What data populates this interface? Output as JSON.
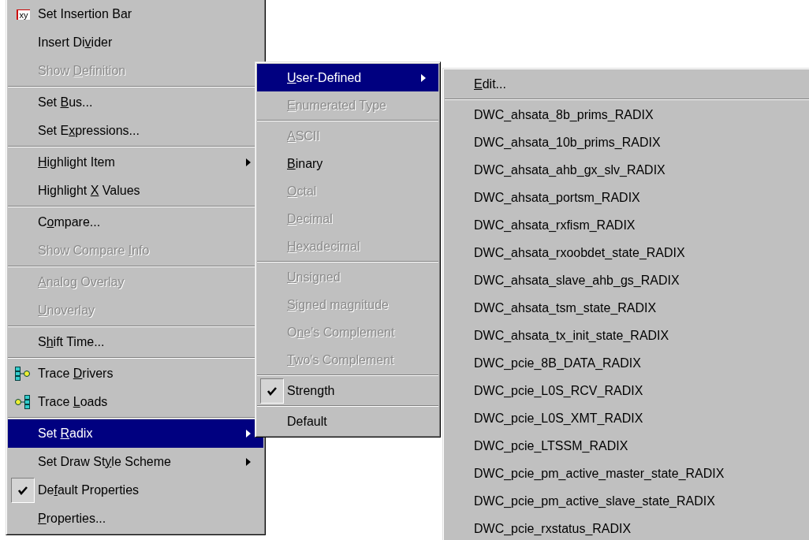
{
  "menus": [
    {
      "kind": "main",
      "items": [
        {
          "kind": "xy",
          "icon_label": "xy",
          "label": "Set Insertion Bar",
          "disabled": false,
          "selected": false,
          "checked": false,
          "submenu": false
        },
        {
          "kind": "item",
          "label": "Insert Di",
          "key": "v",
          "rest": "ider",
          "disabled": false,
          "selected": false,
          "checked": false,
          "submenu": false
        },
        {
          "kind": "item",
          "label": "Show ",
          "key": "D",
          "rest": "efinition",
          "disabled": true,
          "selected": false,
          "checked": false,
          "submenu": false
        },
        {
          "kind": "separator"
        },
        {
          "kind": "item",
          "label": "Set ",
          "key": "B",
          "rest": "us...",
          "disabled": false,
          "selected": false,
          "checked": false,
          "submenu": false
        },
        {
          "kind": "item",
          "label": "Set E",
          "key": "x",
          "rest": "pressions...",
          "disabled": false,
          "selected": false,
          "checked": false,
          "submenu": false
        },
        {
          "kind": "separator"
        },
        {
          "kind": "item",
          "key": "H",
          "rest": "ighlight Item",
          "disabled": false,
          "selected": false,
          "checked": false,
          "submenu": true
        },
        {
          "kind": "item",
          "label": "Highlight ",
          "key": "X",
          "rest": " Values",
          "disabled": false,
          "selected": false,
          "checked": false,
          "submenu": false
        },
        {
          "kind": "separator"
        },
        {
          "kind": "item",
          "label": "C",
          "key": "o",
          "rest": "mpare...",
          "disabled": false,
          "selected": false,
          "checked": false,
          "submenu": false
        },
        {
          "kind": "item",
          "label": "Show Compare ",
          "key": "I",
          "rest": "nfo",
          "disabled": true,
          "selected": false,
          "checked": false,
          "submenu": false
        },
        {
          "kind": "separator"
        },
        {
          "kind": "item",
          "key": "A",
          "rest": "nalog Overlay",
          "disabled": true,
          "selected": false,
          "checked": false,
          "submenu": false
        },
        {
          "kind": "item",
          "key": "U",
          "rest": "noverlay",
          "disabled": true,
          "selected": false,
          "checked": false,
          "submenu": false
        },
        {
          "kind": "separator"
        },
        {
          "kind": "item",
          "label": "S",
          "key": "h",
          "rest": "ift Time...",
          "disabled": false,
          "selected": false,
          "checked": false,
          "submenu": false
        },
        {
          "kind": "separator"
        },
        {
          "kind": "drivers",
          "label": "Trace ",
          "key": "D",
          "rest": "rivers",
          "disabled": false,
          "selected": false,
          "checked": false,
          "submenu": false
        },
        {
          "kind": "loads",
          "label": "Trace ",
          "key": "L",
          "rest": "oads",
          "disabled": false,
          "selected": false,
          "checked": false,
          "submenu": false
        },
        {
          "kind": "separator"
        },
        {
          "kind": "item",
          "label": "Set ",
          "key": "R",
          "rest": "adix",
          "disabled": false,
          "selected": true,
          "checked": false,
          "submenu": true
        },
        {
          "kind": "item",
          "label": "Set Draw St",
          "key": "y",
          "rest": "le Scheme",
          "disabled": false,
          "selected": false,
          "checked": false,
          "submenu": true
        },
        {
          "kind": "item",
          "label": "De",
          "key": "f",
          "rest": "ault Properties",
          "disabled": false,
          "selected": false,
          "checked": true,
          "submenu": false
        },
        {
          "kind": "item",
          "key": "P",
          "rest": "roperties...",
          "disabled": false,
          "selected": false,
          "checked": false,
          "submenu": false
        }
      ]
    },
    {
      "kind": "radix",
      "items": [
        {
          "kind": "item",
          "key": "U",
          "rest": "ser-Defined",
          "disabled": false,
          "selected": true,
          "checked": false,
          "submenu": true
        },
        {
          "kind": "item",
          "key": "E",
          "rest": "numerated Type",
          "disabled": true,
          "selected": false,
          "checked": false,
          "submenu": false
        },
        {
          "kind": "separator"
        },
        {
          "kind": "item",
          "key": "A",
          "rest": "SCII",
          "disabled": true,
          "selected": false,
          "checked": false,
          "submenu": false
        },
        {
          "kind": "item",
          "key": "B",
          "rest": "inary",
          "disabled": false,
          "selected": false,
          "checked": false,
          "submenu": false
        },
        {
          "kind": "item",
          "key": "O",
          "rest": "ctal",
          "disabled": true,
          "selected": false,
          "checked": false,
          "submenu": false
        },
        {
          "kind": "item",
          "key": "D",
          "rest": "ecimal",
          "disabled": true,
          "selected": false,
          "checked": false,
          "submenu": false
        },
        {
          "kind": "item",
          "key": "H",
          "rest": "exadecimal",
          "disabled": true,
          "selected": false,
          "checked": false,
          "submenu": false
        },
        {
          "kind": "separator"
        },
        {
          "kind": "item",
          "key": "U",
          "rest": "nsigned",
          "disabled": true,
          "selected": false,
          "checked": false,
          "submenu": false
        },
        {
          "kind": "item",
          "key": "S",
          "rest": "igned magnitude",
          "disabled": true,
          "selected": false,
          "checked": false,
          "submenu": false
        },
        {
          "kind": "item",
          "label": "O",
          "key": "n",
          "rest": "e's Complement",
          "disabled": true,
          "selected": false,
          "checked": false,
          "submenu": false
        },
        {
          "kind": "item",
          "key": "T",
          "rest": "wo's Complement",
          "disabled": true,
          "selected": false,
          "checked": false,
          "submenu": false
        },
        {
          "kind": "separator"
        },
        {
          "kind": "item",
          "label": "Strength",
          "disabled": false,
          "selected": false,
          "checked": true,
          "submenu": false
        },
        {
          "kind": "separator"
        },
        {
          "kind": "item",
          "label": "Default",
          "disabled": false,
          "selected": false,
          "checked": false,
          "submenu": false
        }
      ]
    },
    {
      "kind": "user",
      "items": [
        {
          "kind": "item",
          "key": "E",
          "rest": "dit...",
          "disabled": false,
          "selected": false,
          "checked": false,
          "submenu": false
        },
        {
          "kind": "separator"
        },
        {
          "kind": "item",
          "label": "DWC_ahsata_8b_prims_RADIX",
          "disabled": false,
          "selected": false,
          "checked": false,
          "submenu": false
        },
        {
          "kind": "item",
          "label": "DWC_ahsata_10b_prims_RADIX",
          "disabled": false,
          "selected": false,
          "checked": false,
          "submenu": false
        },
        {
          "kind": "item",
          "label": "DWC_ahsata_ahb_gx_slv_RADIX",
          "disabled": false,
          "selected": false,
          "checked": false,
          "submenu": false
        },
        {
          "kind": "item",
          "label": "DWC_ahsata_portsm_RADIX",
          "disabled": false,
          "selected": false,
          "checked": false,
          "submenu": false
        },
        {
          "kind": "item",
          "label": "DWC_ahsata_rxfism_RADIX",
          "disabled": false,
          "selected": false,
          "checked": false,
          "submenu": false
        },
        {
          "kind": "item",
          "label": "DWC_ahsata_rxoobdet_state_RADIX",
          "disabled": false,
          "selected": false,
          "checked": false,
          "submenu": false
        },
        {
          "kind": "item",
          "label": "DWC_ahsata_slave_ahb_gs_RADIX",
          "disabled": false,
          "selected": false,
          "checked": false,
          "submenu": false
        },
        {
          "kind": "item",
          "label": "DWC_ahsata_tsm_state_RADIX",
          "disabled": false,
          "selected": false,
          "checked": false,
          "submenu": false
        },
        {
          "kind": "item",
          "label": "DWC_ahsata_tx_init_state_RADIX",
          "disabled": false,
          "selected": false,
          "checked": false,
          "submenu": false
        },
        {
          "kind": "item",
          "label": "DWC_pcie_8B_DATA_RADIX",
          "disabled": false,
          "selected": false,
          "checked": false,
          "submenu": false
        },
        {
          "kind": "item",
          "label": "DWC_pcie_L0S_RCV_RADIX",
          "disabled": false,
          "selected": false,
          "checked": false,
          "submenu": false
        },
        {
          "kind": "item",
          "label": "DWC_pcie_L0S_XMT_RADIX",
          "disabled": false,
          "selected": false,
          "checked": false,
          "submenu": false
        },
        {
          "kind": "item",
          "label": "DWC_pcie_LTSSM_RADIX",
          "disabled": false,
          "selected": false,
          "checked": false,
          "submenu": false
        },
        {
          "kind": "item",
          "label": "DWC_pcie_pm_active_master_state_RADIX",
          "disabled": false,
          "selected": false,
          "checked": false,
          "submenu": false
        },
        {
          "kind": "item",
          "label": "DWC_pcie_pm_active_slave_state_RADIX",
          "disabled": false,
          "selected": false,
          "checked": false,
          "submenu": false
        },
        {
          "kind": "item",
          "label": "DWC_pcie_rxstatus_RADIX",
          "disabled": false,
          "selected": false,
          "checked": false,
          "submenu": false
        }
      ]
    }
  ]
}
